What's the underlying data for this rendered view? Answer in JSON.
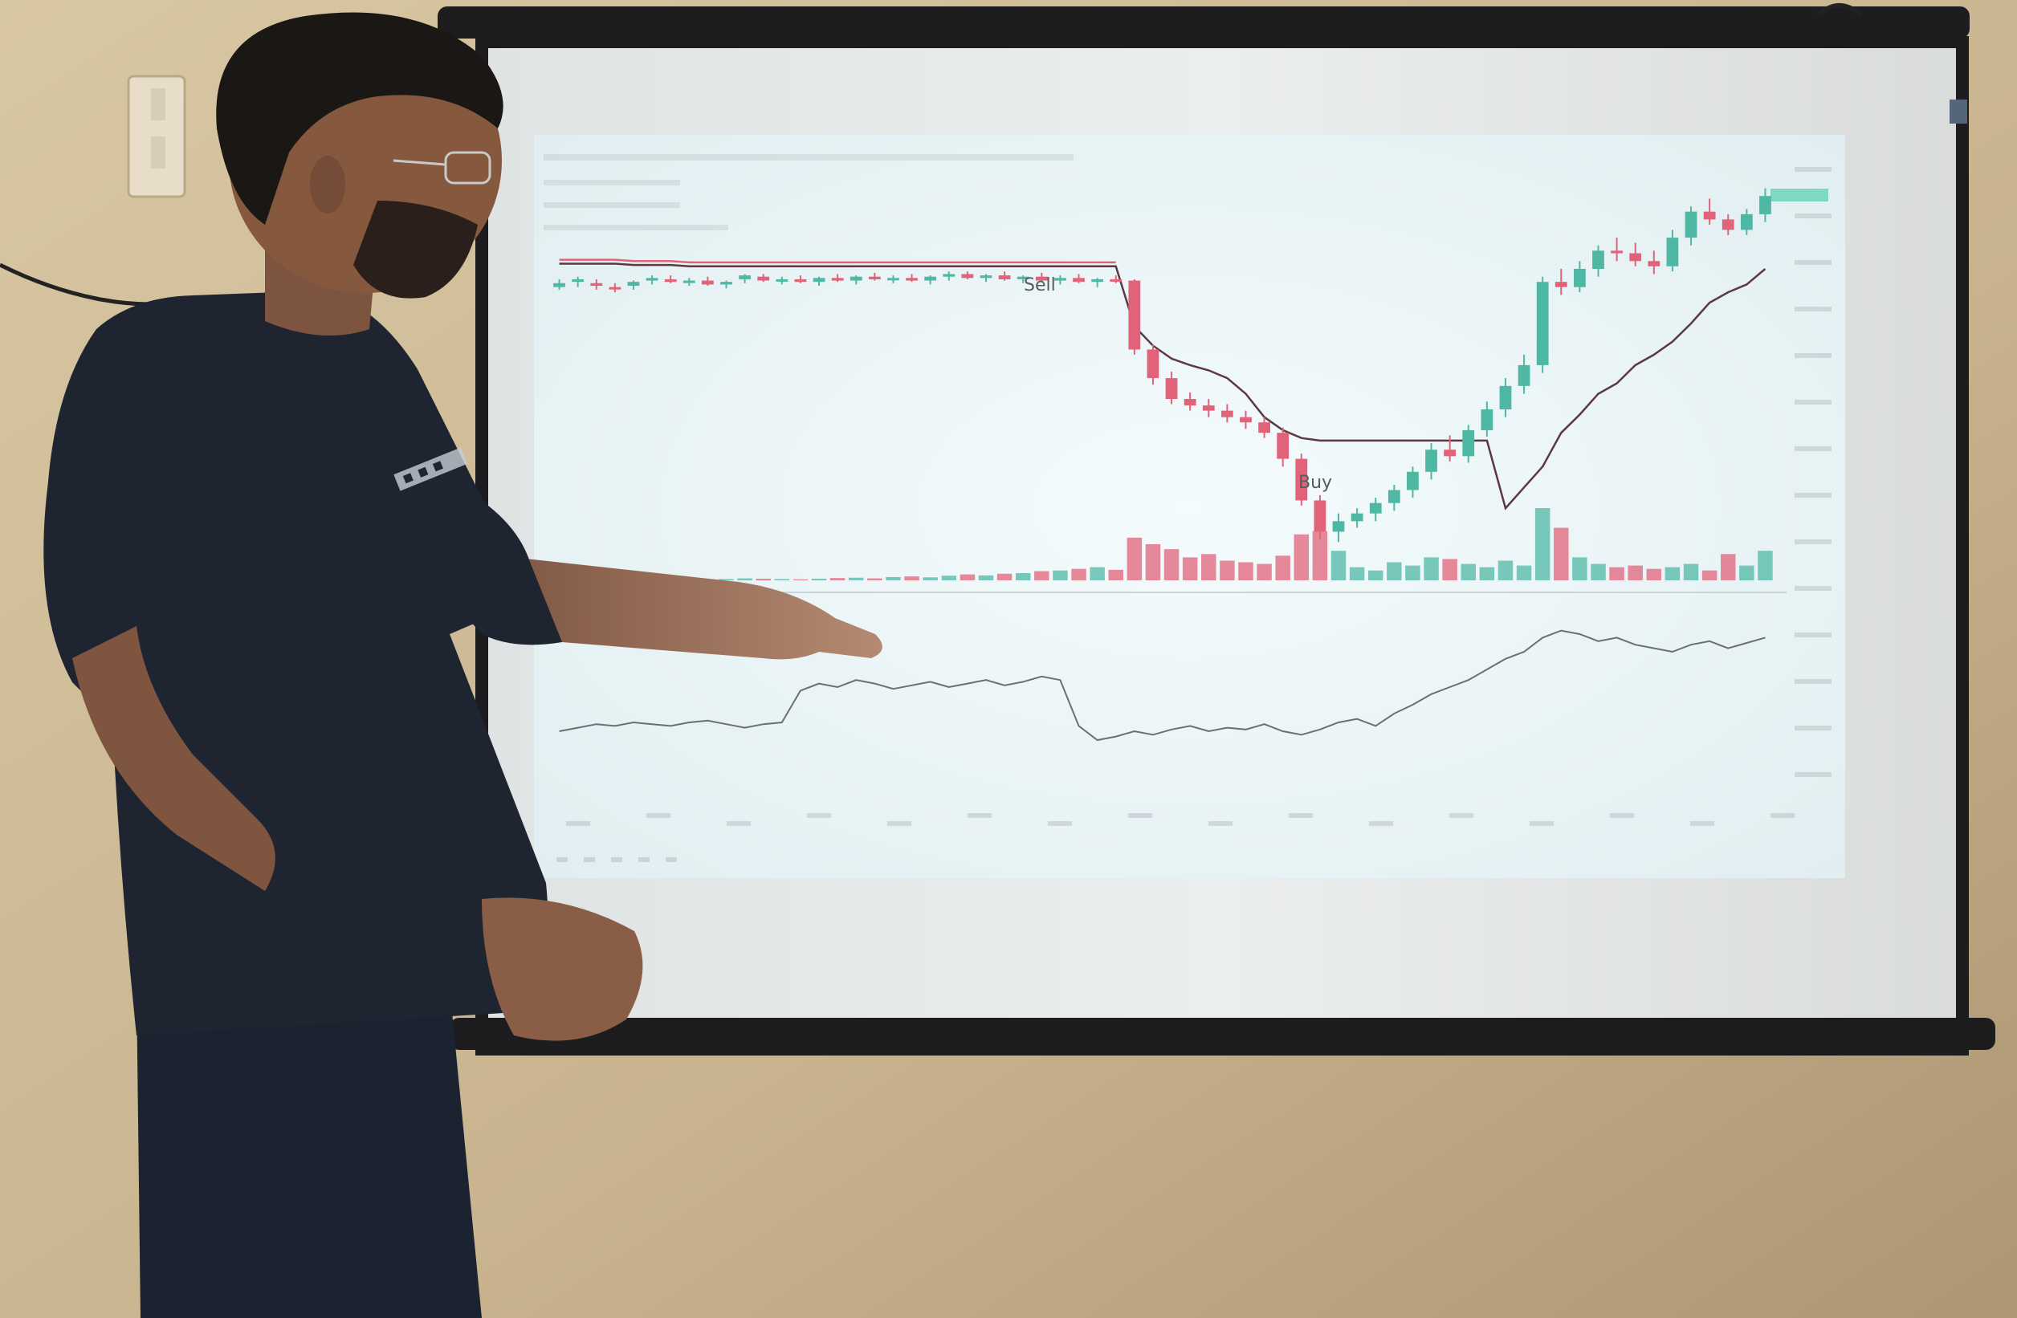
{
  "chart_annotations": {
    "sell_label": "Sell",
    "buy_label": "Buy"
  },
  "colors": {
    "wall": "#c9b48f",
    "screen": "#e8eced",
    "projection": "#eef6f8",
    "bullish": "#4fb8a5",
    "bearish": "#e0637a",
    "shirt": "#1f2431",
    "skin": "#9a6b4f"
  },
  "chart_series": {
    "candles": [
      [
        0,
        400,
        406,
        398,
        403
      ],
      [
        1,
        404,
        408,
        400,
        406
      ],
      [
        2,
        403,
        406,
        398,
        401
      ],
      [
        3,
        400,
        403,
        396,
        399
      ],
      [
        4,
        401,
        405,
        398,
        404
      ],
      [
        5,
        405,
        409,
        402,
        407
      ],
      [
        6,
        406,
        409,
        403,
        404
      ],
      [
        7,
        404,
        407,
        401,
        405
      ],
      [
        8,
        405,
        408,
        401,
        402
      ],
      [
        9,
        402,
        405,
        399,
        404
      ],
      [
        10,
        406,
        410,
        403,
        409
      ],
      [
        11,
        408,
        410,
        404,
        405
      ],
      [
        12,
        405,
        408,
        402,
        406
      ],
      [
        13,
        406,
        409,
        403,
        404
      ],
      [
        14,
        404,
        408,
        401,
        407
      ],
      [
        15,
        407,
        410,
        404,
        405
      ],
      [
        16,
        405,
        409,
        402,
        408
      ],
      [
        17,
        408,
        411,
        405,
        406
      ],
      [
        18,
        406,
        409,
        403,
        407
      ],
      [
        19,
        407,
        410,
        404,
        405
      ],
      [
        20,
        405,
        409,
        402,
        408
      ],
      [
        21,
        408,
        412,
        405,
        410
      ],
      [
        22,
        410,
        412,
        406,
        407
      ],
      [
        23,
        407,
        410,
        404,
        409
      ],
      [
        24,
        409,
        412,
        405,
        406
      ],
      [
        25,
        406,
        409,
        403,
        408
      ],
      [
        26,
        408,
        411,
        404,
        405
      ],
      [
        27,
        405,
        409,
        402,
        407
      ],
      [
        28,
        407,
        410,
        403,
        404
      ],
      [
        29,
        404,
        407,
        400,
        406
      ],
      [
        30,
        406,
        409,
        403,
        405
      ],
      [
        31,
        405,
        406,
        348,
        352
      ],
      [
        32,
        352,
        356,
        325,
        330
      ],
      [
        33,
        330,
        335,
        310,
        314
      ],
      [
        34,
        314,
        319,
        305,
        309
      ],
      [
        35,
        309,
        314,
        300,
        305
      ],
      [
        36,
        305,
        310,
        296,
        300
      ],
      [
        37,
        300,
        305,
        291,
        296
      ],
      [
        38,
        296,
        300,
        284,
        288
      ],
      [
        39,
        288,
        292,
        262,
        268
      ],
      [
        40,
        268,
        272,
        232,
        236
      ],
      [
        41,
        236,
        240,
        206,
        212
      ],
      [
        42,
        212,
        226,
        204,
        220
      ],
      [
        43,
        220,
        230,
        215,
        226
      ],
      [
        44,
        226,
        238,
        220,
        234
      ],
      [
        45,
        234,
        248,
        228,
        244
      ],
      [
        46,
        244,
        262,
        238,
        258
      ],
      [
        47,
        258,
        280,
        252,
        275
      ],
      [
        48,
        275,
        286,
        266,
        270
      ],
      [
        49,
        270,
        294,
        265,
        290
      ],
      [
        50,
        290,
        312,
        285,
        306
      ],
      [
        51,
        306,
        330,
        300,
        324
      ],
      [
        52,
        324,
        348,
        318,
        340
      ],
      [
        53,
        340,
        408,
        334,
        404
      ],
      [
        54,
        404,
        414,
        394,
        400
      ],
      [
        55,
        400,
        420,
        396,
        414
      ],
      [
        56,
        414,
        432,
        408,
        428
      ],
      [
        57,
        428,
        438,
        420,
        426
      ],
      [
        58,
        426,
        434,
        416,
        420
      ],
      [
        59,
        420,
        428,
        410,
        416
      ],
      [
        60,
        416,
        444,
        412,
        438
      ],
      [
        61,
        438,
        462,
        432,
        458
      ],
      [
        62,
        458,
        468,
        448,
        452
      ],
      [
        63,
        452,
        456,
        440,
        444
      ],
      [
        64,
        444,
        460,
        440,
        456
      ],
      [
        65,
        456,
        476,
        450,
        470
      ]
    ],
    "volumes": [
      4,
      3,
      5,
      4,
      3,
      6,
      4,
      5,
      3,
      4,
      6,
      5,
      4,
      3,
      5,
      7,
      8,
      6,
      10,
      12,
      9,
      14,
      18,
      15,
      20,
      22,
      28,
      30,
      35,
      40,
      32,
      130,
      110,
      95,
      70,
      80,
      60,
      55,
      50,
      75,
      140,
      150,
      90,
      40,
      30,
      55,
      45,
      70,
      65,
      50,
      40,
      60,
      45,
      220,
      160,
      70,
      50,
      40,
      45,
      35,
      40,
      50,
      30,
      80,
      45,
      90
    ],
    "trailing_stop": [
      418,
      418,
      418,
      418,
      417,
      417,
      417,
      416,
      416,
      416,
      416,
      416,
      416,
      416,
      416,
      416,
      416,
      416,
      416,
      416,
      416,
      416,
      416,
      416,
      416,
      416,
      416,
      416,
      416,
      416,
      416,
      370,
      355,
      345,
      340,
      336,
      330,
      318,
      300,
      290,
      284,
      282,
      282,
      282,
      282,
      282,
      282,
      282,
      282,
      282,
      282,
      230,
      246,
      262,
      288,
      302,
      318,
      326,
      340,
      348,
      358,
      372,
      388,
      396,
      402,
      414
    ],
    "oscillator": [
      35,
      37,
      39,
      38,
      40,
      39,
      38,
      40,
      41,
      39,
      37,
      39,
      40,
      58,
      62,
      60,
      64,
      62,
      59,
      61,
      63,
      60,
      62,
      64,
      61,
      63,
      66,
      64,
      38,
      30,
      32,
      35,
      33,
      36,
      38,
      35,
      37,
      36,
      39,
      35,
      33,
      36,
      40,
      42,
      38,
      45,
      50,
      56,
      60,
      64,
      70,
      76,
      80,
      88,
      92,
      90,
      86,
      88,
      84,
      82,
      80,
      84,
      86,
      82,
      85,
      88
    ]
  }
}
